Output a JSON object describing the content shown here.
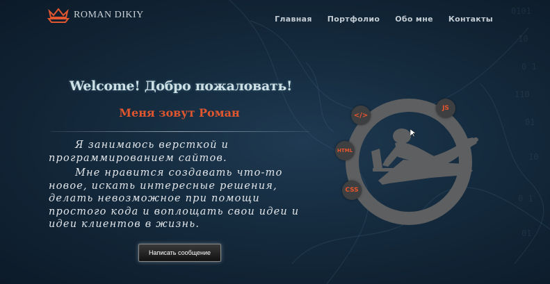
{
  "header": {
    "logo_text": "ROMAN DIKIY",
    "logo_icon": "crown-boat-icon",
    "nav": [
      {
        "label": "Главная"
      },
      {
        "label": "Портфолио"
      },
      {
        "label": "Обо мне"
      },
      {
        "label": "Контакты"
      }
    ]
  },
  "hero": {
    "welcome": "Welcome! Добро пожаловать!",
    "name": "Меня зовут  Роман",
    "paragraph1": "Я занимаюсь версткой и программированием сайтов.",
    "paragraph2": "Мне нравится создавать что-то новое, искать интересные решения, делать невозможное при помощи простого кода и воплощать свои идеи и идеи клиентов в жизнь.",
    "cta_label": "Написать сообщение"
  },
  "illustration": {
    "badges": [
      {
        "label": "</>"
      },
      {
        "label": "JS"
      },
      {
        "label": "HTML"
      },
      {
        "label": "CSS"
      }
    ]
  },
  "colors": {
    "accent": "#e0562f",
    "background": "#142a3d",
    "ring": "#5e5f61"
  }
}
